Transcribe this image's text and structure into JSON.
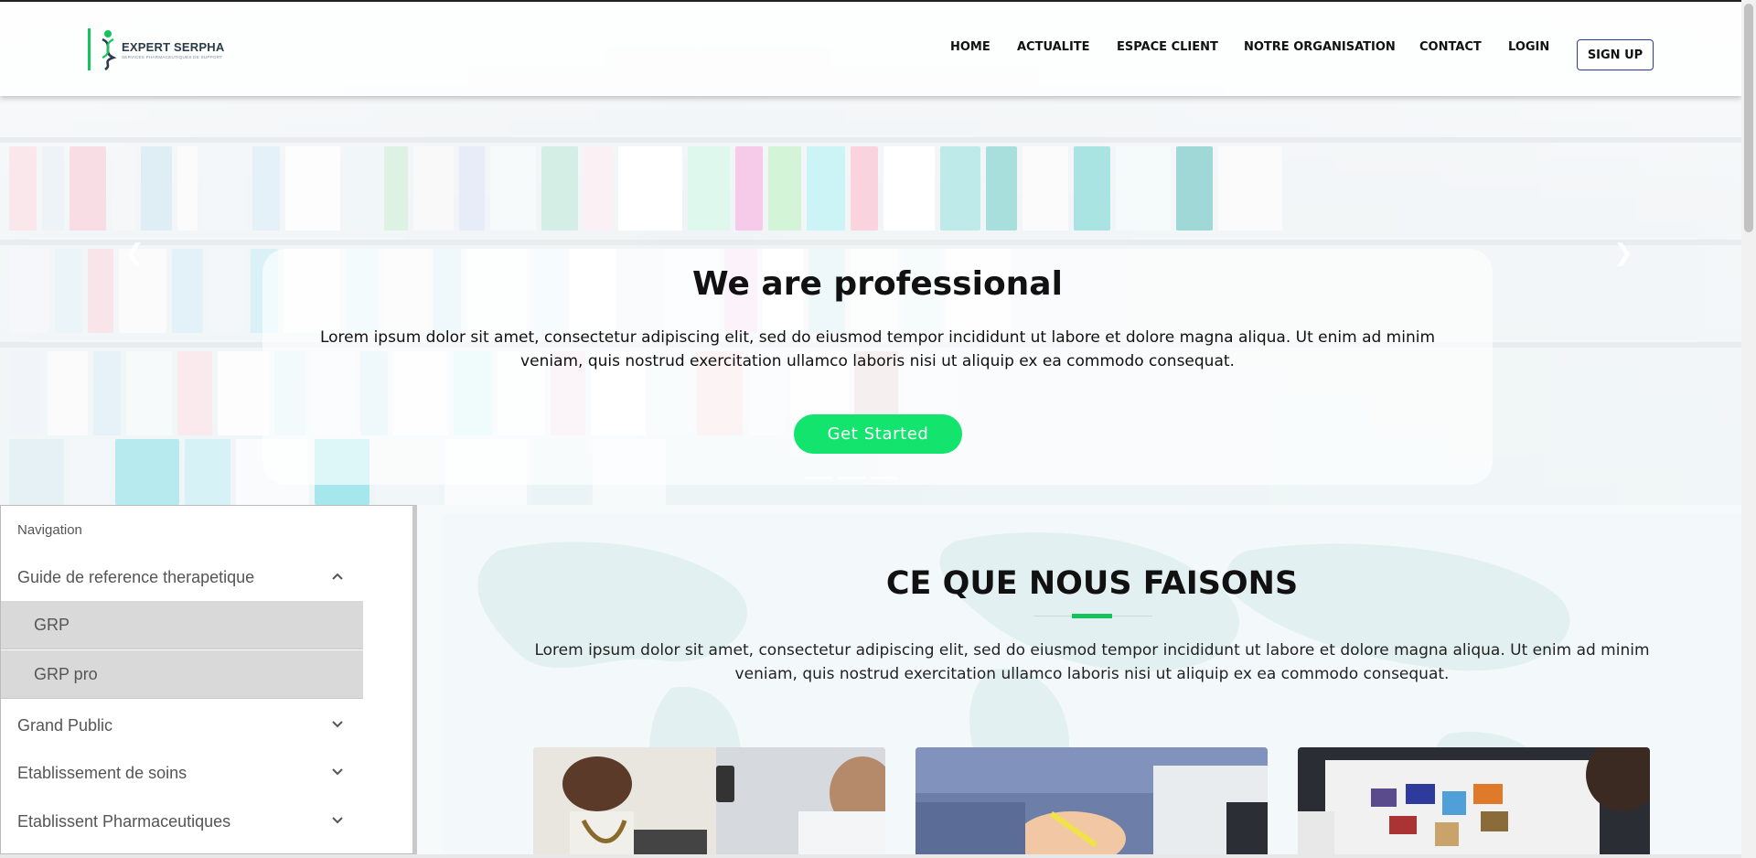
{
  "header": {
    "logo_title": "EXPERT SERPHA",
    "logo_subtitle": "SERVICES PHARMACEUTIQUES DE SUPPORT",
    "nav": [
      {
        "label": "HOME"
      },
      {
        "label": "ACTUALITE"
      },
      {
        "label": "ESPACE CLIENT"
      },
      {
        "label": "NOTRE ORGANISATION"
      },
      {
        "label": "CONTACT"
      },
      {
        "label": "LOGIN"
      }
    ],
    "signup_label": "SIGN UP"
  },
  "hero": {
    "title": "We are professional",
    "text": "Lorem ipsum dolor sit amet, consectetur adipiscing elit, sed do eiusmod tempor incididunt ut labore et dolore magna aliqua. Ut enim ad minim veniam, quis nostrud exercitation ullamco laboris nisi ut aliquip ex ea commodo consequat.",
    "cta_label": "Get Started",
    "prev_icon": "chevron-left-icon",
    "next_icon": "chevron-right-icon",
    "slide_count": 3,
    "active_slide": 1
  },
  "sidebar": {
    "heading": "Navigation",
    "items": [
      {
        "label": "Guide de reference therapetique",
        "expanded": true,
        "children": [
          {
            "label": "GRP"
          },
          {
            "label": "GRP pro"
          }
        ]
      },
      {
        "label": "Grand Public",
        "expanded": false
      },
      {
        "label": "Etablissement de soins",
        "expanded": false
      },
      {
        "label": "Etablissent Pharmaceutiques",
        "expanded": false
      }
    ]
  },
  "section": {
    "title": "CE QUE NOUS FAISONS",
    "text": "Lorem ipsum dolor sit amet, consectetur adipiscing elit, sed do eiusmod tempor incididunt ut labore et dolore magna aliqua. Ut enim ad minim veniam, quis nostrud exercitation ullamco laboris nisi ut aliquip ex ea commodo consequat."
  },
  "colors": {
    "accent_green": "#13e46e",
    "logo_green": "#12c55c",
    "signup_border": "#2b3a9a",
    "sidebar_selected": "#d9d9d9"
  }
}
